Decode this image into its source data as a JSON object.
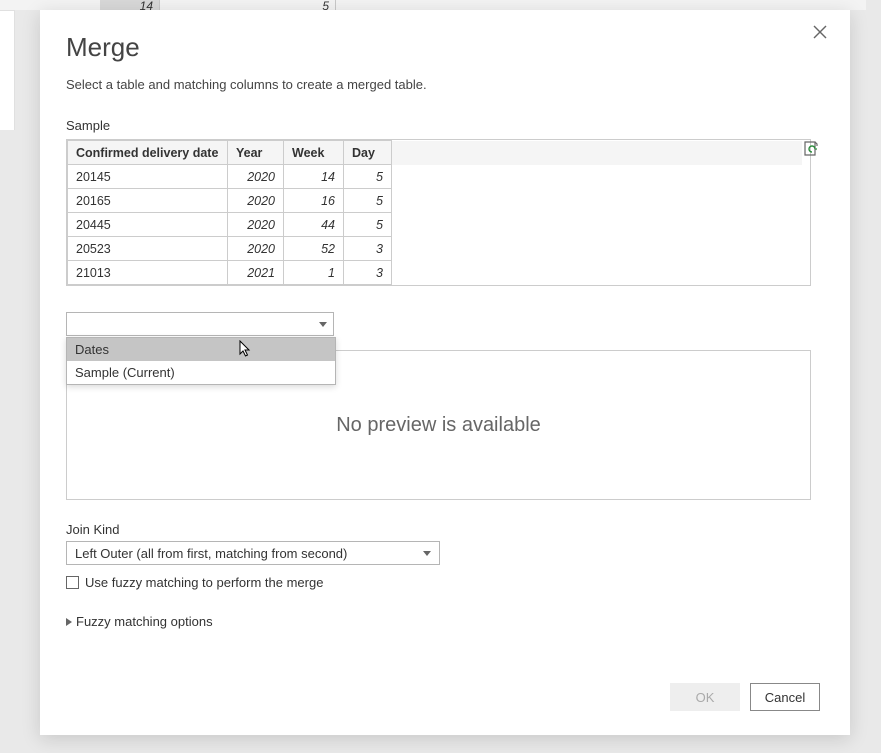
{
  "bg_cells": {
    "c1": "14",
    "c2": "5"
  },
  "dialog": {
    "title": "Merge",
    "description": "Select a table and matching columns to create a merged table.",
    "table1_label": "Sample",
    "columns": [
      "Confirmed delivery date",
      "Year",
      "Week",
      "Day"
    ],
    "rows": [
      {
        "cdd": "20145",
        "year": "2020",
        "week": "14",
        "day": "5"
      },
      {
        "cdd": "20165",
        "year": "2020",
        "week": "16",
        "day": "5"
      },
      {
        "cdd": "20445",
        "year": "2020",
        "week": "44",
        "day": "5"
      },
      {
        "cdd": "20523",
        "year": "2020",
        "week": "52",
        "day": "3"
      },
      {
        "cdd": "21013",
        "year": "2021",
        "week": "1",
        "day": "3"
      }
    ],
    "table2_combo_value": "",
    "table2_options": [
      "Dates",
      "Sample (Current)"
    ],
    "preview_text": "No preview is available",
    "join_kind_label": "Join Kind",
    "join_kind_value": "Left Outer (all from first, matching from second)",
    "fuzzy_checkbox_label": "Use fuzzy matching to perform the merge",
    "fuzzy_expander_label": "Fuzzy matching options",
    "ok_label": "OK",
    "cancel_label": "Cancel"
  }
}
